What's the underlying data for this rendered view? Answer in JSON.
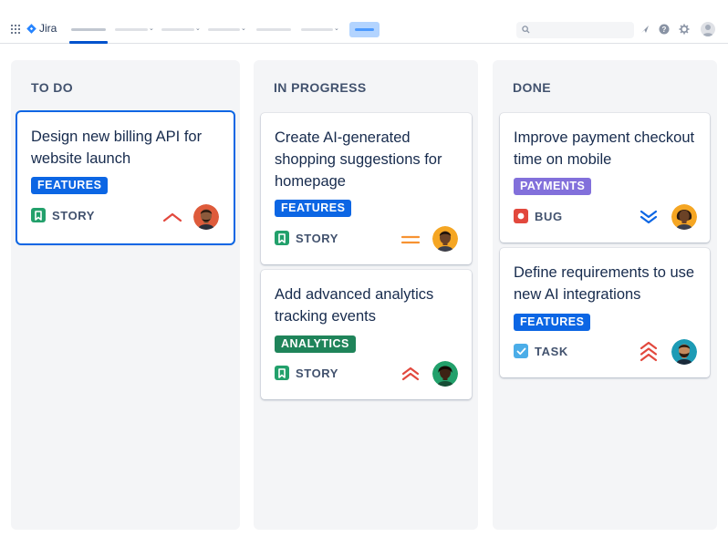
{
  "app": {
    "name": "Jira"
  },
  "columns": [
    {
      "title": "TO DO",
      "cards": [
        {
          "title": "Design new billing API for website launch",
          "label": "FEATURES",
          "label_color": "#0c66e4",
          "type": "STORY",
          "type_icon": "story-icon",
          "priority": "high",
          "avatar_skin": "#8b5a3c",
          "avatar_bg": "#de5b3b"
        }
      ]
    },
    {
      "title": "IN PROGRESS",
      "cards": [
        {
          "title": "Create AI-generated shopping suggestions for homepage",
          "label": "FEATURES",
          "label_color": "#0c66e4",
          "type": "STORY",
          "type_icon": "story-icon",
          "priority": "medium",
          "avatar_skin": "#6b4226",
          "avatar_bg": "#f5a623"
        },
        {
          "title": "Add advanced analytics tracking events",
          "label": "ANALYTICS",
          "label_color": "#1f845a",
          "type": "STORY",
          "type_icon": "story-icon",
          "priority": "high",
          "avatar_skin": "#3d2314",
          "avatar_bg": "#22a06b"
        }
      ]
    },
    {
      "title": "DONE",
      "cards": [
        {
          "title": "Improve payment checkout time on mobile",
          "label": "PAYMENTS",
          "label_color": "#8270db",
          "type": "BUG",
          "type_icon": "bug-icon",
          "priority": "lowest",
          "avatar_skin": "#6b4226",
          "avatar_bg": "#f5a623"
        },
        {
          "title": "Define requirements to use new AI integrations",
          "label": "FEATURES",
          "label_color": "#0c66e4",
          "type": "TASK",
          "type_icon": "task-icon",
          "priority": "highest",
          "avatar_skin": "#c48a5e",
          "avatar_bg": "#1d9bb5"
        }
      ]
    }
  ],
  "colors": {
    "story": "#22a06b",
    "bug": "#e2483d",
    "task": "#4bade8",
    "priority_high": "#e2483d",
    "priority_medium": "#f79232",
    "priority_lowest": "#0c66e4",
    "selected_border": "#0c66e4"
  }
}
